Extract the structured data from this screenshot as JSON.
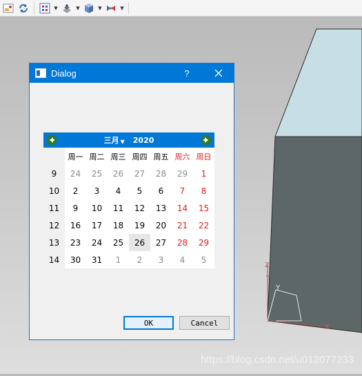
{
  "toolbar": {
    "icons": [
      "image-icon",
      "refresh-icon",
      "grid-icon",
      "render-mode-icon",
      "cube-icon",
      "view-icon"
    ]
  },
  "dialog": {
    "title": "Dialog",
    "help_label": "?",
    "ok_label": "OK",
    "cancel_label": "Cancel"
  },
  "calendar": {
    "month_label": "三月",
    "year_label": "2020",
    "weekday_headers": [
      "周一",
      "周二",
      "周三",
      "周四",
      "周五",
      "周六",
      "周日"
    ],
    "weeks": [
      {
        "week": "9",
        "days": [
          "24",
          "25",
          "26",
          "27",
          "28",
          "29",
          "1"
        ]
      },
      {
        "week": "10",
        "days": [
          "2",
          "3",
          "4",
          "5",
          "6",
          "7",
          "8"
        ]
      },
      {
        "week": "11",
        "days": [
          "9",
          "10",
          "11",
          "12",
          "13",
          "14",
          "15"
        ]
      },
      {
        "week": "12",
        "days": [
          "16",
          "17",
          "18",
          "19",
          "20",
          "21",
          "22"
        ]
      },
      {
        "week": "13",
        "days": [
          "23",
          "24",
          "25",
          "26",
          "27",
          "28",
          "29"
        ]
      },
      {
        "week": "14",
        "days": [
          "30",
          "31",
          "1",
          "2",
          "3",
          "4",
          "5"
        ]
      }
    ],
    "other_month_days": {
      "first_row_count": 6,
      "last_row_count": 5
    },
    "selected_day": "26",
    "weekend_color": "#e21b1b",
    "header_color": "#0078d7"
  },
  "scene": {
    "axis_labels": {
      "x": "X",
      "y": "Y",
      "z": "Z"
    },
    "watermark": "https://blog.csdn.net/u012077233"
  }
}
